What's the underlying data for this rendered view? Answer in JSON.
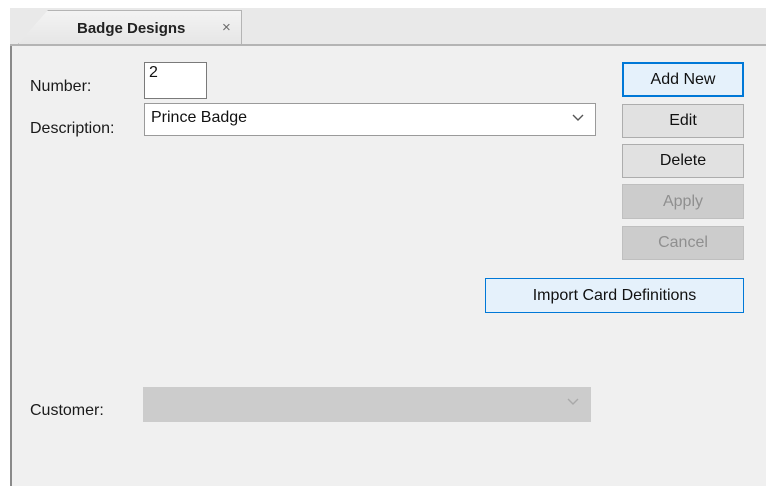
{
  "tab": {
    "title": "Badge Designs",
    "close_icon": "close-icon",
    "close_glyph": "×"
  },
  "form": {
    "number_label": "Number:",
    "number_value": "2",
    "description_label": "Description:",
    "description_value": "Prince Badge",
    "customer_label": "Customer:",
    "customer_value": ""
  },
  "buttons": {
    "add_new": "Add New",
    "edit": "Edit",
    "delete": "Delete",
    "apply": "Apply",
    "cancel": "Cancel",
    "import_card_definitions": "Import Card Definitions"
  },
  "colors": {
    "panel_bg": "#f0f0f0",
    "focus_accent": "#0078d7",
    "disabled_bg": "#cccccc"
  }
}
